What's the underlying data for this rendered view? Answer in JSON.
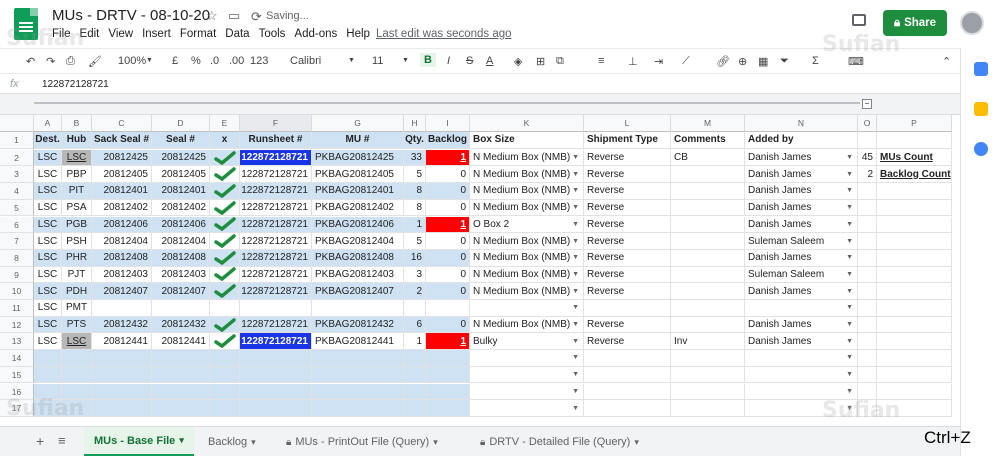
{
  "doc": {
    "title": "MUs - DRTV - 08-10-20",
    "saving": "Saving...",
    "last_edit": "Last edit was seconds ago",
    "share_label": "Share"
  },
  "menu": [
    "File",
    "Edit",
    "View",
    "Insert",
    "Format",
    "Data",
    "Tools",
    "Add-ons",
    "Help"
  ],
  "toolbar": {
    "zoom": "100%",
    "currency": "£",
    "percent": "%",
    "dec_less": ".0",
    "dec_more": ".00",
    "format": "123",
    "font": "Calibri",
    "size": "11",
    "bold": "B",
    "italic": "I",
    "strike": "S",
    "underline_a": "A"
  },
  "formula": {
    "fx": "fx",
    "value": "122872128721"
  },
  "columns": [
    "A",
    "B",
    "C",
    "D",
    "E",
    "F",
    "G",
    "H",
    "I",
    "K",
    "L",
    "M",
    "N",
    "O",
    "P"
  ],
  "headers": [
    "Dest.",
    "Hub",
    "Sack Seal #",
    "Seal #",
    "x",
    "Runsheet #",
    "MU #",
    "Qty.",
    "Backlog",
    "Box Size",
    "Shipment Type",
    "Comments",
    "Added by",
    "",
    ""
  ],
  "rows": [
    {
      "n": "2",
      "dest": "LSC",
      "hub": "LSC",
      "sack": "20812425",
      "seal": "20812425",
      "chk": true,
      "run": "122872128721",
      "mu": "PKBAG20812425",
      "qty": "33",
      "backlog": "1",
      "box": "N Medium Box (NMB)",
      "ship": "Reverse",
      "comm": "CB",
      "added": "Danish James",
      "o": "45",
      "p": "MUs Count"
    },
    {
      "n": "3",
      "dest": "LSC",
      "hub": "PBP",
      "sack": "20812405",
      "seal": "20812405",
      "chk": true,
      "run": "122872128721",
      "mu": "PKBAG20812405",
      "qty": "5",
      "backlog": "0",
      "box": "N Medium Box (NMB)",
      "ship": "Reverse",
      "comm": "",
      "added": "Danish James",
      "o": "2",
      "p": "Backlog Count"
    },
    {
      "n": "4",
      "dest": "LSC",
      "hub": "PIT",
      "sack": "20812401",
      "seal": "20812401",
      "chk": true,
      "run": "122872128721",
      "mu": "PKBAG20812401",
      "qty": "8",
      "backlog": "0",
      "box": "N Medium Box (NMB)",
      "ship": "Reverse",
      "comm": "",
      "added": "Danish James",
      "o": "",
      "p": ""
    },
    {
      "n": "5",
      "dest": "LSC",
      "hub": "PSA",
      "sack": "20812402",
      "seal": "20812402",
      "chk": true,
      "run": "122872128721",
      "mu": "PKBAG20812402",
      "qty": "8",
      "backlog": "0",
      "box": "N Medium Box (NMB)",
      "ship": "Reverse",
      "comm": "",
      "added": "Danish James",
      "o": "",
      "p": ""
    },
    {
      "n": "6",
      "dest": "LSC",
      "hub": "PGB",
      "sack": "20812406",
      "seal": "20812406",
      "chk": true,
      "run": "122872128721",
      "mu": "PKBAG20812406",
      "qty": "1",
      "backlog": "1",
      "box": "O Box 2",
      "ship": "Reverse",
      "comm": "",
      "added": "Danish James",
      "o": "",
      "p": ""
    },
    {
      "n": "7",
      "dest": "LSC",
      "hub": "PSH",
      "sack": "20812404",
      "seal": "20812404",
      "chk": true,
      "run": "122872128721",
      "mu": "PKBAG20812404",
      "qty": "5",
      "backlog": "0",
      "box": "N Medium Box (NMB)",
      "ship": "Reverse",
      "comm": "",
      "added": "Suleman Saleem",
      "o": "",
      "p": ""
    },
    {
      "n": "8",
      "dest": "LSC",
      "hub": "PHR",
      "sack": "20812408",
      "seal": "20812408",
      "chk": true,
      "run": "122872128721",
      "mu": "PKBAG20812408",
      "qty": "16",
      "backlog": "0",
      "box": "N Medium Box (NMB)",
      "ship": "Reverse",
      "comm": "",
      "added": "Danish James",
      "o": "",
      "p": ""
    },
    {
      "n": "9",
      "dest": "LSC",
      "hub": "PJT",
      "sack": "20812403",
      "seal": "20812403",
      "chk": true,
      "run": "122872128721",
      "mu": "PKBAG20812403",
      "qty": "3",
      "backlog": "0",
      "box": "N Medium Box (NMB)",
      "ship": "Reverse",
      "comm": "",
      "added": "Suleman Saleem",
      "o": "",
      "p": ""
    },
    {
      "n": "10",
      "dest": "LSC",
      "hub": "PDH",
      "sack": "20812407",
      "seal": "20812407",
      "chk": true,
      "run": "122872128721",
      "mu": "PKBAG20812407",
      "qty": "2",
      "backlog": "0",
      "box": "N Medium Box (NMB)",
      "ship": "Reverse",
      "comm": "",
      "added": "Danish James",
      "o": "",
      "p": ""
    },
    {
      "n": "11",
      "dest": "LSC",
      "hub": "PMT",
      "sack": "",
      "seal": "",
      "chk": false,
      "run": "",
      "mu": "",
      "qty": "",
      "backlog": "",
      "box": "",
      "ship": "",
      "comm": "",
      "added": "",
      "o": "",
      "p": ""
    },
    {
      "n": "12",
      "dest": "LSC",
      "hub": "PTS",
      "sack": "20812432",
      "seal": "20812432",
      "chk": true,
      "run": "122872128721",
      "mu": "PKBAG20812432",
      "qty": "6",
      "backlog": "0",
      "box": "N Medium Box (NMB)",
      "ship": "Reverse",
      "comm": "",
      "added": "Danish James",
      "o": "",
      "p": ""
    },
    {
      "n": "13",
      "dest": "LSC",
      "hub": "LSC",
      "sack": "20812441",
      "seal": "20812441",
      "chk": true,
      "run": "122872128721",
      "mu": "PKBAG20812441",
      "qty": "1",
      "backlog": "1",
      "box": "Bulky",
      "ship": "Reverse",
      "comm": "Inv",
      "added": "Danish James",
      "o": "",
      "p": ""
    },
    {
      "n": "14",
      "dest": "",
      "hub": "",
      "sack": "",
      "seal": "",
      "chk": false,
      "run": "",
      "mu": "",
      "qty": "",
      "backlog": "",
      "box": "",
      "ship": "",
      "comm": "",
      "added": "",
      "o": "",
      "p": ""
    },
    {
      "n": "15",
      "dest": "",
      "hub": "",
      "sack": "",
      "seal": "",
      "chk": false,
      "run": "",
      "mu": "",
      "qty": "",
      "backlog": "",
      "box": "",
      "ship": "",
      "comm": "",
      "added": "",
      "o": "",
      "p": ""
    },
    {
      "n": "16",
      "dest": "",
      "hub": "",
      "sack": "",
      "seal": "",
      "chk": false,
      "run": "",
      "mu": "",
      "qty": "",
      "backlog": "",
      "box": "",
      "ship": "",
      "comm": "",
      "added": "",
      "o": "",
      "p": ""
    },
    {
      "n": "17",
      "dest": "",
      "hub": "",
      "sack": "",
      "seal": "",
      "chk": false,
      "run": "",
      "mu": "",
      "qty": "",
      "backlog": "",
      "box": "",
      "ship": "",
      "comm": "",
      "added": "",
      "o": "",
      "p": ""
    }
  ],
  "row1_label": "1",
  "tabs": [
    {
      "label": "MUs - Base File",
      "active": true,
      "locked": false
    },
    {
      "label": "Backlog",
      "active": false,
      "locked": false
    },
    {
      "label": "MUs - PrintOut File (Query)",
      "active": false,
      "locked": true
    },
    {
      "label": "DRTV - Detailed File (Query)",
      "active": false,
      "locked": true
    }
  ],
  "overlay": "Ctrl+Z",
  "watermark": "Sufian",
  "colors": {
    "accent_green": "#0f9d58",
    "runsheet_blue": "#1a35e8",
    "backlog_red": "#ff0000",
    "header_blue": "#cfe2f3"
  }
}
